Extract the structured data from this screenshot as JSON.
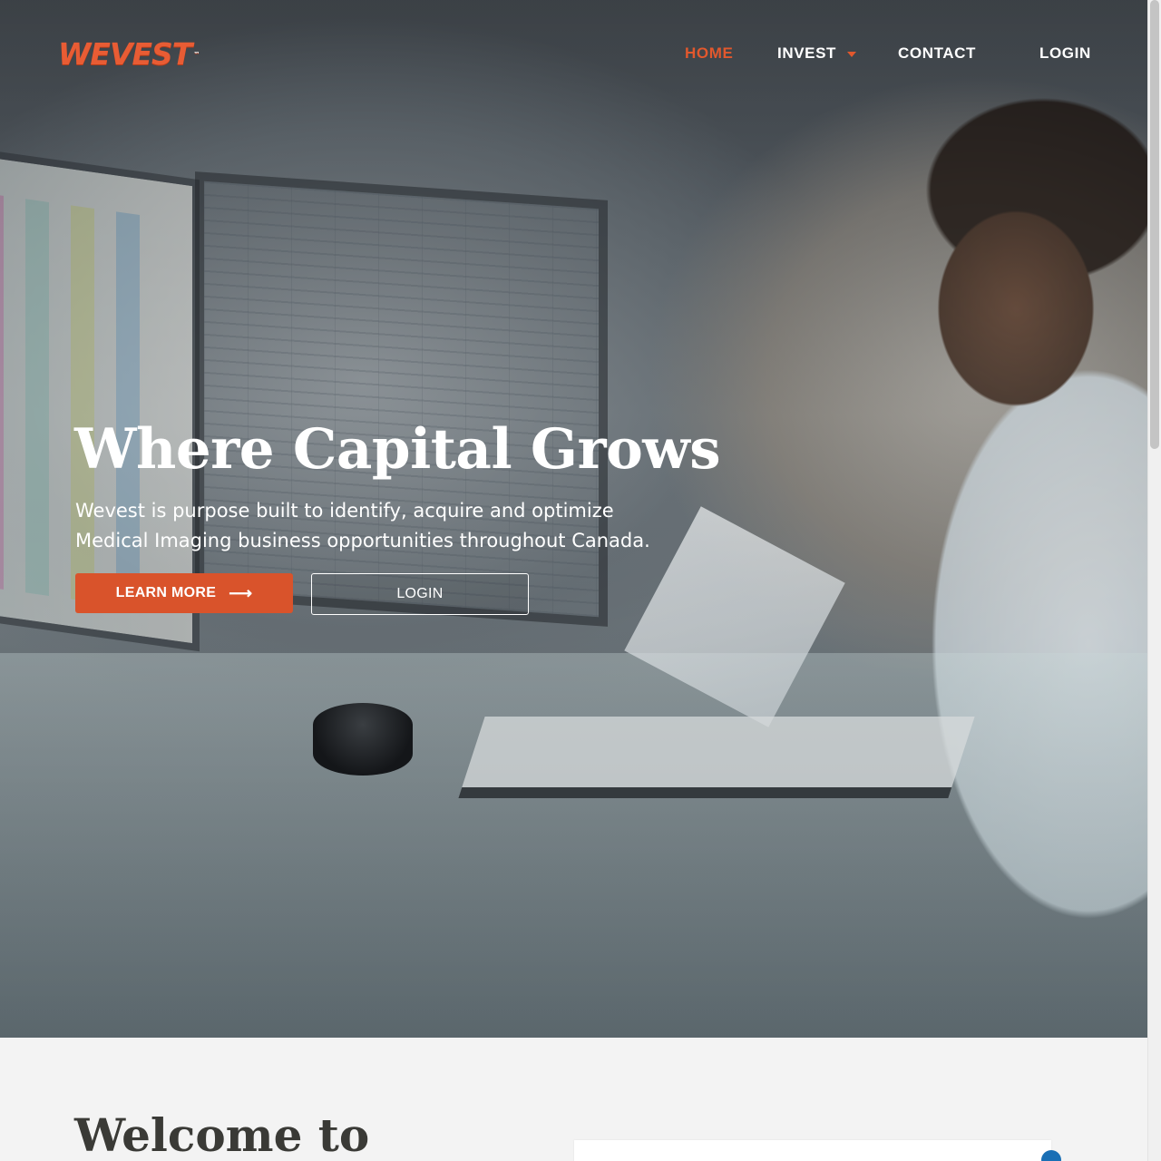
{
  "brand": {
    "logo_text": "WEVEST",
    "trademark": "™",
    "accent": "#e2582d"
  },
  "nav": {
    "home": "HOME",
    "invest": "INVEST",
    "contact": "CONTACT",
    "login": "LOGIN"
  },
  "hero": {
    "title": "Where Capital Grows",
    "subtitle_line1": "Wevest is purpose built to identify, acquire and optimize",
    "subtitle_line2": "Medical Imaging business opportunities throughout Canada.",
    "learn_more": "LEARN MORE",
    "arrow_glyph": "⟶",
    "login": "LOGIN"
  },
  "welcome": {
    "heading": "Welcome to"
  }
}
